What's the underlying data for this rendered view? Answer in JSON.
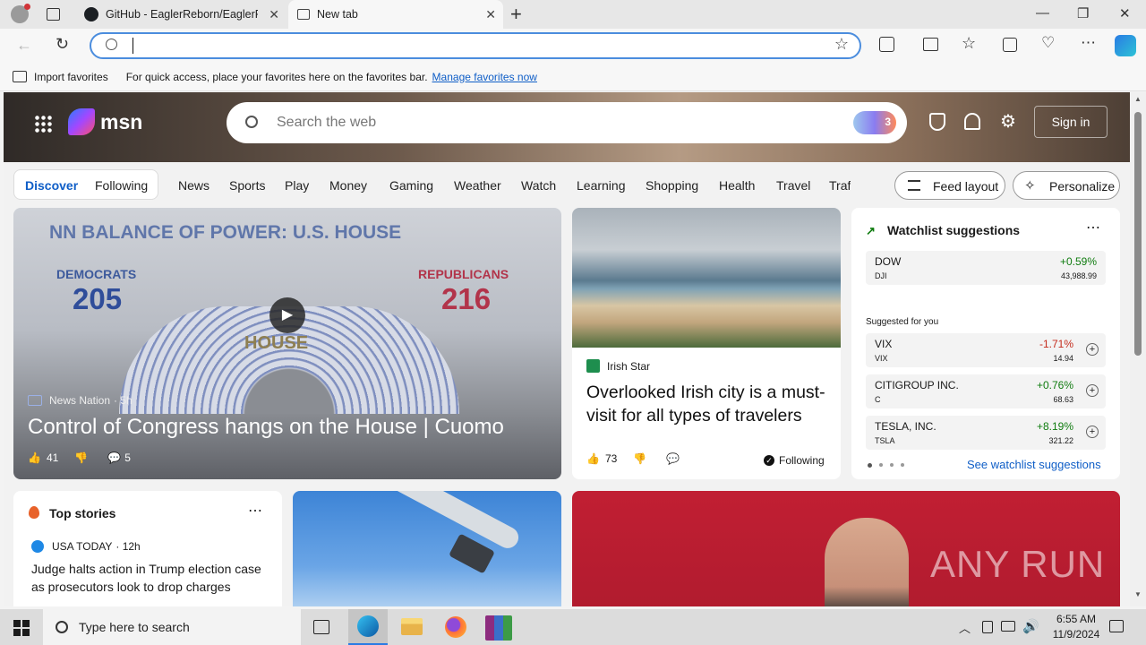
{
  "browser": {
    "tabs": [
      {
        "label": "GitHub - EaglerReborn/EaglerFor"
      },
      {
        "label": "New tab"
      }
    ],
    "new_tab_symbol": "+",
    "address_value": "",
    "window_controls": {
      "minimize": "—",
      "restore": "❐",
      "close": "✕"
    }
  },
  "favorites_bar": {
    "import_label": "Import favorites",
    "hint": "For quick access, place your favorites here on the favorites bar.",
    "manage_link": "Manage favorites now"
  },
  "msn": {
    "logo": "msn",
    "search_placeholder": "Search the web",
    "copilot_badge": "3",
    "sign_in": "Sign in",
    "tabs": {
      "discover": "Discover",
      "following": "Following"
    },
    "nav": [
      "News",
      "Sports",
      "Play",
      "Money",
      "Gaming",
      "Weather",
      "Watch",
      "Learning",
      "Shopping",
      "Health",
      "Travel",
      "Traf"
    ],
    "feed_layout": "Feed layout",
    "personalize": "Personalize"
  },
  "hero_card": {
    "overlay_banner": "NN BALANCE OF POWER: U.S. HOUSE",
    "dem_label": "DEMOCRATS",
    "dem_value": "205",
    "rep_label": "REPUBLICANS",
    "rep_value": "216",
    "house_label": "HOUSE",
    "source": "News Nation",
    "age": "· 5h",
    "headline": "Control of Congress hangs on the House | Cuomo",
    "likes": "41",
    "comments": "5"
  },
  "irish_card": {
    "source": "Irish Star",
    "headline": "Overlooked Irish city is a must-visit for all types of travelers",
    "likes": "73",
    "following": "Following"
  },
  "watchlist": {
    "title": "Watchlist suggestions",
    "dow": {
      "name": "DOW",
      "symbol": "DJI",
      "change": "+0.59%",
      "value": "43,988.99"
    },
    "suggested_label": "Suggested for you",
    "stocks": [
      {
        "name": "VIX",
        "symbol": "VIX",
        "change": "-1.71%",
        "value": "14.94",
        "color": "#c42b1c"
      },
      {
        "name": "CITIGROUP INC.",
        "symbol": "C",
        "change": "+0.76%",
        "value": "68.63",
        "color": "#107c10"
      },
      {
        "name": "TESLA, INC.",
        "symbol": "TSLA",
        "change": "+8.19%",
        "value": "321.22",
        "color": "#107c10"
      }
    ],
    "see_link": "See watchlist suggestions"
  },
  "top_stories": {
    "title": "Top stories",
    "source": "USA TODAY",
    "age": "· 12h",
    "headline": "Judge halts action in Trump election case as prosecutors look to drop charges"
  },
  "watermark": "ANY RUN",
  "taskbar": {
    "search_placeholder": "Type here to search",
    "time": "6:55 AM",
    "date": "11/9/2024"
  }
}
